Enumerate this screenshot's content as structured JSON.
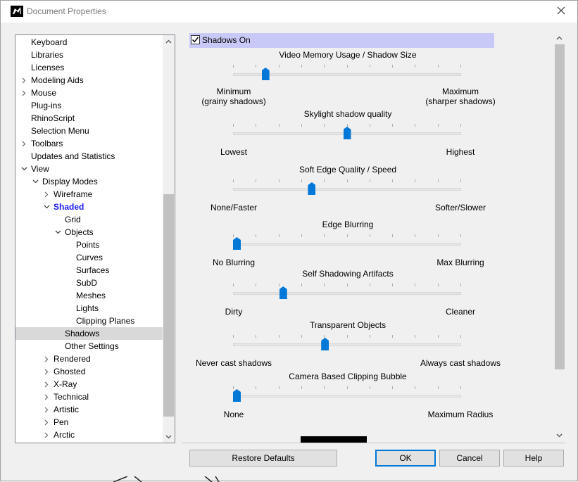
{
  "window": {
    "title": "Document Properties",
    "icon": "rhino-app-icon",
    "close_icon": "close-icon"
  },
  "tree": {
    "items": [
      {
        "label": "Keyboard",
        "level": 0,
        "expander": "none"
      },
      {
        "label": "Libraries",
        "level": 0,
        "expander": "none"
      },
      {
        "label": "Licenses",
        "level": 0,
        "expander": "none"
      },
      {
        "label": "Modeling Aids",
        "level": 0,
        "expander": "collapsed"
      },
      {
        "label": "Mouse",
        "level": 0,
        "expander": "collapsed"
      },
      {
        "label": "Plug-ins",
        "level": 0,
        "expander": "none"
      },
      {
        "label": "RhinoScript",
        "level": 0,
        "expander": "none"
      },
      {
        "label": "Selection Menu",
        "level": 0,
        "expander": "none"
      },
      {
        "label": "Toolbars",
        "level": 0,
        "expander": "collapsed"
      },
      {
        "label": "Updates and Statistics",
        "level": 0,
        "expander": "none"
      },
      {
        "label": "View",
        "level": 0,
        "expander": "expanded"
      },
      {
        "label": "Display Modes",
        "level": 1,
        "expander": "expanded"
      },
      {
        "label": "Wireframe",
        "level": 2,
        "expander": "collapsed"
      },
      {
        "label": "Shaded",
        "level": 2,
        "expander": "expanded",
        "bold": true
      },
      {
        "label": "Grid",
        "level": 3,
        "expander": "none"
      },
      {
        "label": "Objects",
        "level": 3,
        "expander": "expanded"
      },
      {
        "label": "Points",
        "level": 4,
        "expander": "none"
      },
      {
        "label": "Curves",
        "level": 4,
        "expander": "none"
      },
      {
        "label": "Surfaces",
        "level": 4,
        "expander": "none"
      },
      {
        "label": "SubD",
        "level": 4,
        "expander": "none"
      },
      {
        "label": "Meshes",
        "level": 4,
        "expander": "none"
      },
      {
        "label": "Lights",
        "level": 4,
        "expander": "none"
      },
      {
        "label": "Clipping Planes",
        "level": 4,
        "expander": "none"
      },
      {
        "label": "Shadows",
        "level": 3,
        "expander": "none",
        "selected": true
      },
      {
        "label": "Other Settings",
        "level": 3,
        "expander": "none"
      },
      {
        "label": "Rendered",
        "level": 2,
        "expander": "collapsed"
      },
      {
        "label": "Ghosted",
        "level": 2,
        "expander": "collapsed"
      },
      {
        "label": "X-Ray",
        "level": 2,
        "expander": "collapsed"
      },
      {
        "label": "Technical",
        "level": 2,
        "expander": "collapsed"
      },
      {
        "label": "Artistic",
        "level": 2,
        "expander": "collapsed"
      },
      {
        "label": "Pen",
        "level": 2,
        "expander": "collapsed"
      },
      {
        "label": "Arctic",
        "level": 2,
        "expander": "collapsed"
      }
    ]
  },
  "shadows_on": {
    "label": "Shadows On",
    "checked": true
  },
  "sliders": [
    {
      "title": "Video Memory Usage / Shadow Size",
      "min_label": "Minimum\n(grainy shadows)",
      "max_label": "Maximum\n(sharper shadows)",
      "fraction": 0.13
    },
    {
      "title": "Skylight shadow quality",
      "min_label": "Lowest",
      "max_label": "Highest",
      "fraction": 0.5
    },
    {
      "title": "Soft Edge Quality / Speed",
      "min_label": "None/Faster",
      "max_label": "Softer/Slower",
      "fraction": 0.34
    },
    {
      "title": "Edge Blurring",
      "min_label": "No Blurring",
      "max_label": "Max Blurring",
      "fraction": 0.0
    },
    {
      "title": "Self Shadowing Artifacts",
      "min_label": "Dirty",
      "max_label": "Cleaner",
      "fraction": 0.21
    },
    {
      "title": "Transparent Objects",
      "min_label": "Never cast shadows",
      "max_label": "Always cast shadows",
      "fraction": 0.4
    },
    {
      "title": "Camera Based Clipping Bubble",
      "min_label": "None",
      "max_label": "Maximum Radius",
      "fraction": 0.0
    }
  ],
  "buttons": {
    "restore": "Restore Defaults",
    "ok": "OK",
    "cancel": "Cancel",
    "help": "Help"
  },
  "colors": {
    "accent": "#0078d7",
    "highlight": "#c9c9f7",
    "selected_row": "#d9d9d9",
    "bold_item": "#1a1aff"
  }
}
